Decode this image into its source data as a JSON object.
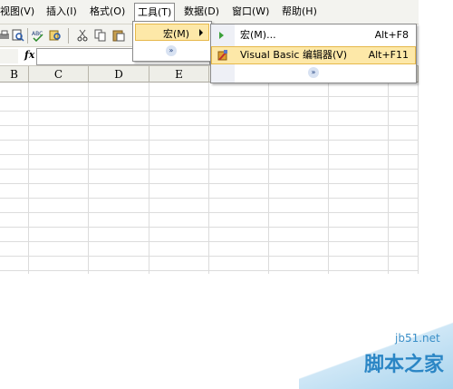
{
  "menubar": {
    "items": [
      "视图(V)",
      "插入(I)",
      "格式(O)",
      "工具(T)",
      "数据(D)",
      "窗口(W)",
      "帮助(H)"
    ]
  },
  "formula_bar": {
    "fx_label": "fx",
    "value": ""
  },
  "columns": [
    "B",
    "C",
    "D",
    "E"
  ],
  "tools_menu": {
    "items": [
      {
        "label": "宏(M)",
        "has_submenu": true
      }
    ],
    "expand_glyph": "»"
  },
  "macro_submenu": {
    "items": [
      {
        "label": "宏(M)...",
        "shortcut": "Alt+F8",
        "icon": "play-icon"
      },
      {
        "label": "Visual Basic 编辑器(V)",
        "shortcut": "Alt+F11",
        "icon": "vb-editor-icon"
      }
    ],
    "expand_glyph": "»"
  },
  "watermark": {
    "site": "jb51.net",
    "text": "脚本之家"
  },
  "colors": {
    "highlight": "#fde8a8",
    "highlight_border": "#e6b84a",
    "menubar_bg": "#f3f3ef",
    "watermark": "#2b86c5"
  }
}
